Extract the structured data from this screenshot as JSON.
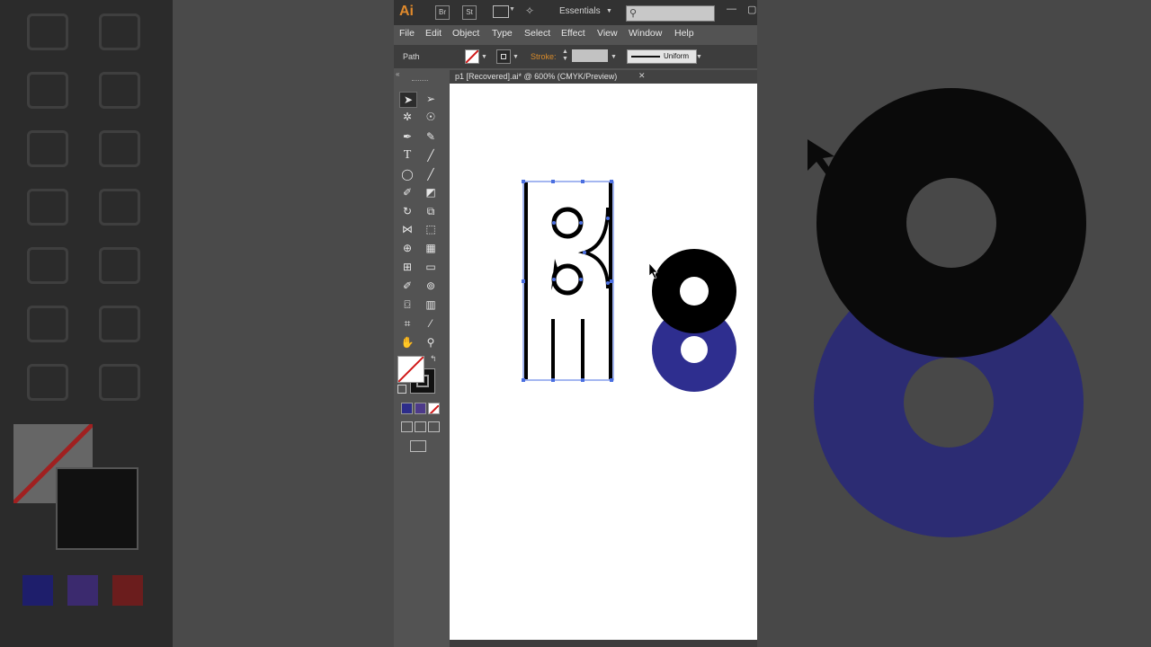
{
  "app": {
    "logo": "Ai",
    "bridge_label": "Br",
    "stock_label": "St",
    "workspace": "Essentials",
    "search_placeholder": ""
  },
  "menu": [
    "File",
    "Edit",
    "Object",
    "Type",
    "Select",
    "Effect",
    "View",
    "Window",
    "Help"
  ],
  "control_bar": {
    "selection_type": "Path",
    "stroke_label": "Stroke:",
    "stroke_profile": "Uniform"
  },
  "document": {
    "tab_title": "p1 [Recovered].ai* @ 600% (CMYK/Preview)",
    "close_glyph": "✕"
  },
  "tools": [
    "selection-tool",
    "direct-selection-tool",
    "magic-wand-tool",
    "lasso-tool",
    "pen-tool",
    "curvature-tool",
    "type-tool",
    "line-tool",
    "ellipse-tool",
    "paintbrush-tool",
    "shaper-tool",
    "eraser-tool",
    "rotate-tool",
    "scale-tool",
    "width-tool",
    "free-transform-tool",
    "shape-builder-tool",
    "perspective-grid-tool",
    "mesh-tool",
    "gradient-tool",
    "eyedropper-tool",
    "blend-tool",
    "symbol-sprayer-tool",
    "column-graph-tool",
    "artboard-tool",
    "slice-tool",
    "hand-tool",
    "zoom-tool"
  ],
  "colors": {
    "accent_orange": "#e08a2c",
    "artwork_black": "#000000",
    "artwork_blue": "#2e2e8f",
    "selection_blue": "#4a6ee0"
  }
}
